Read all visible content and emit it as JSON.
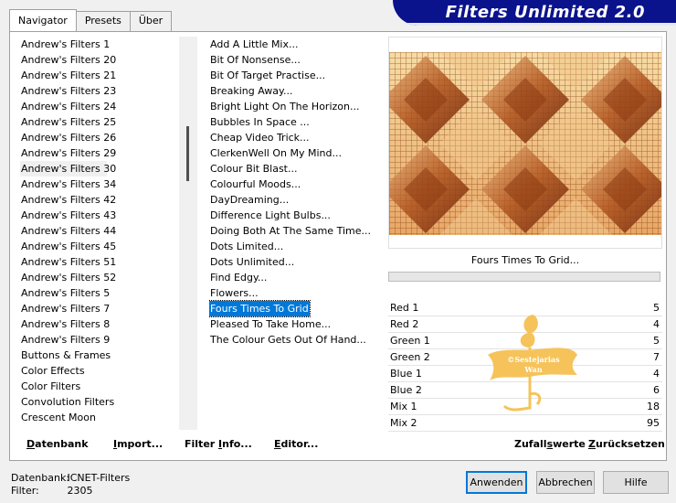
{
  "tabs": [
    "Navigator",
    "Presets",
    "Über"
  ],
  "banner_title": "Filters Unlimited 2.0",
  "categories": [
    "Andrew's Filters 1",
    "Andrew's Filters 20",
    "Andrew's Filters 21",
    "Andrew's Filters 23",
    "Andrew's Filters 24",
    "Andrew's Filters 25",
    "Andrew's Filters 26",
    "Andrew's Filters 29",
    "Andrew's Filters 30",
    "Andrew's Filters 34",
    "Andrew's Filters 42",
    "Andrew's Filters 43",
    "Andrew's Filters 44",
    "Andrew's Filters 45",
    "Andrew's Filters 51",
    "Andrew's Filters 52",
    "Andrew's Filters 5",
    "Andrew's Filters 7",
    "Andrew's Filters 8",
    "Andrew's Filters 9",
    "Buttons & Frames",
    "Color Effects",
    "Color Filters",
    "Convolution Filters",
    "Crescent Moon"
  ],
  "selected_category": "Andrew's Filters 30",
  "filters": [
    "Add A Little Mix...",
    "Bit Of Nonsense...",
    "Bit Of Target Practise...",
    "Breaking Away...",
    "Bright Light On The Horizon...",
    "Bubbles In Space ...",
    "Cheap Video Trick...",
    "ClerkenWell On My Mind...",
    "Colour Bit Blast...",
    "Colourful Moods...",
    "DayDreaming...",
    "Difference Light Bulbs...",
    "Doing Both At The Same Time...",
    "Dots Limited...",
    "Dots Unlimited...",
    "Find Edgy...",
    "Flowers...",
    "Fours Times To Grid...",
    "Pleased To Take Home...",
    "The Colour Gets Out Of Hand..."
  ],
  "selected_filter": "Fours Times To Grid...",
  "filter_name_display": "Fours Times To Grid...",
  "params": [
    {
      "name": "Red 1",
      "value": "5"
    },
    {
      "name": "Red 2",
      "value": "4"
    },
    {
      "name": "Green 1",
      "value": "5"
    },
    {
      "name": "Green 2",
      "value": "7"
    },
    {
      "name": "Blue 1",
      "value": "4"
    },
    {
      "name": "Blue 2",
      "value": "6"
    },
    {
      "name": "Mix 1",
      "value": "18"
    },
    {
      "name": "Mix 2",
      "value": "95"
    }
  ],
  "watermark_text": [
    "©Sestejarias",
    "Wan"
  ],
  "bottom_buttons": {
    "datenbank": {
      "u": "D",
      "rest": "atenbank"
    },
    "import": {
      "u": "I",
      "rest": "mport..."
    },
    "filter_info": {
      "pre": "Filter ",
      "u": "I",
      "rest": "nfo..."
    },
    "editor": {
      "u": "E",
      "rest": "ditor..."
    },
    "zufallswerte": {
      "pre": "Zufall",
      "u": "s",
      "rest": "werte"
    },
    "zuruecksetzen": {
      "u": "Z",
      "rest": "urücksetzen"
    }
  },
  "status": {
    "db_label": "Datenbank:",
    "db_value": "ICNET-Filters",
    "filter_label": "Filter:",
    "filter_value": "2305"
  },
  "dialog_buttons": {
    "apply": "Anwenden",
    "cancel": "Abbrechen",
    "help": "Hilfe"
  },
  "colors": {
    "banner": "#0a128c",
    "selection": "#0078d7",
    "preview_light": "#f4d9a0",
    "preview_dark": "#7a2e0c",
    "watermark": "#f5c35a"
  }
}
